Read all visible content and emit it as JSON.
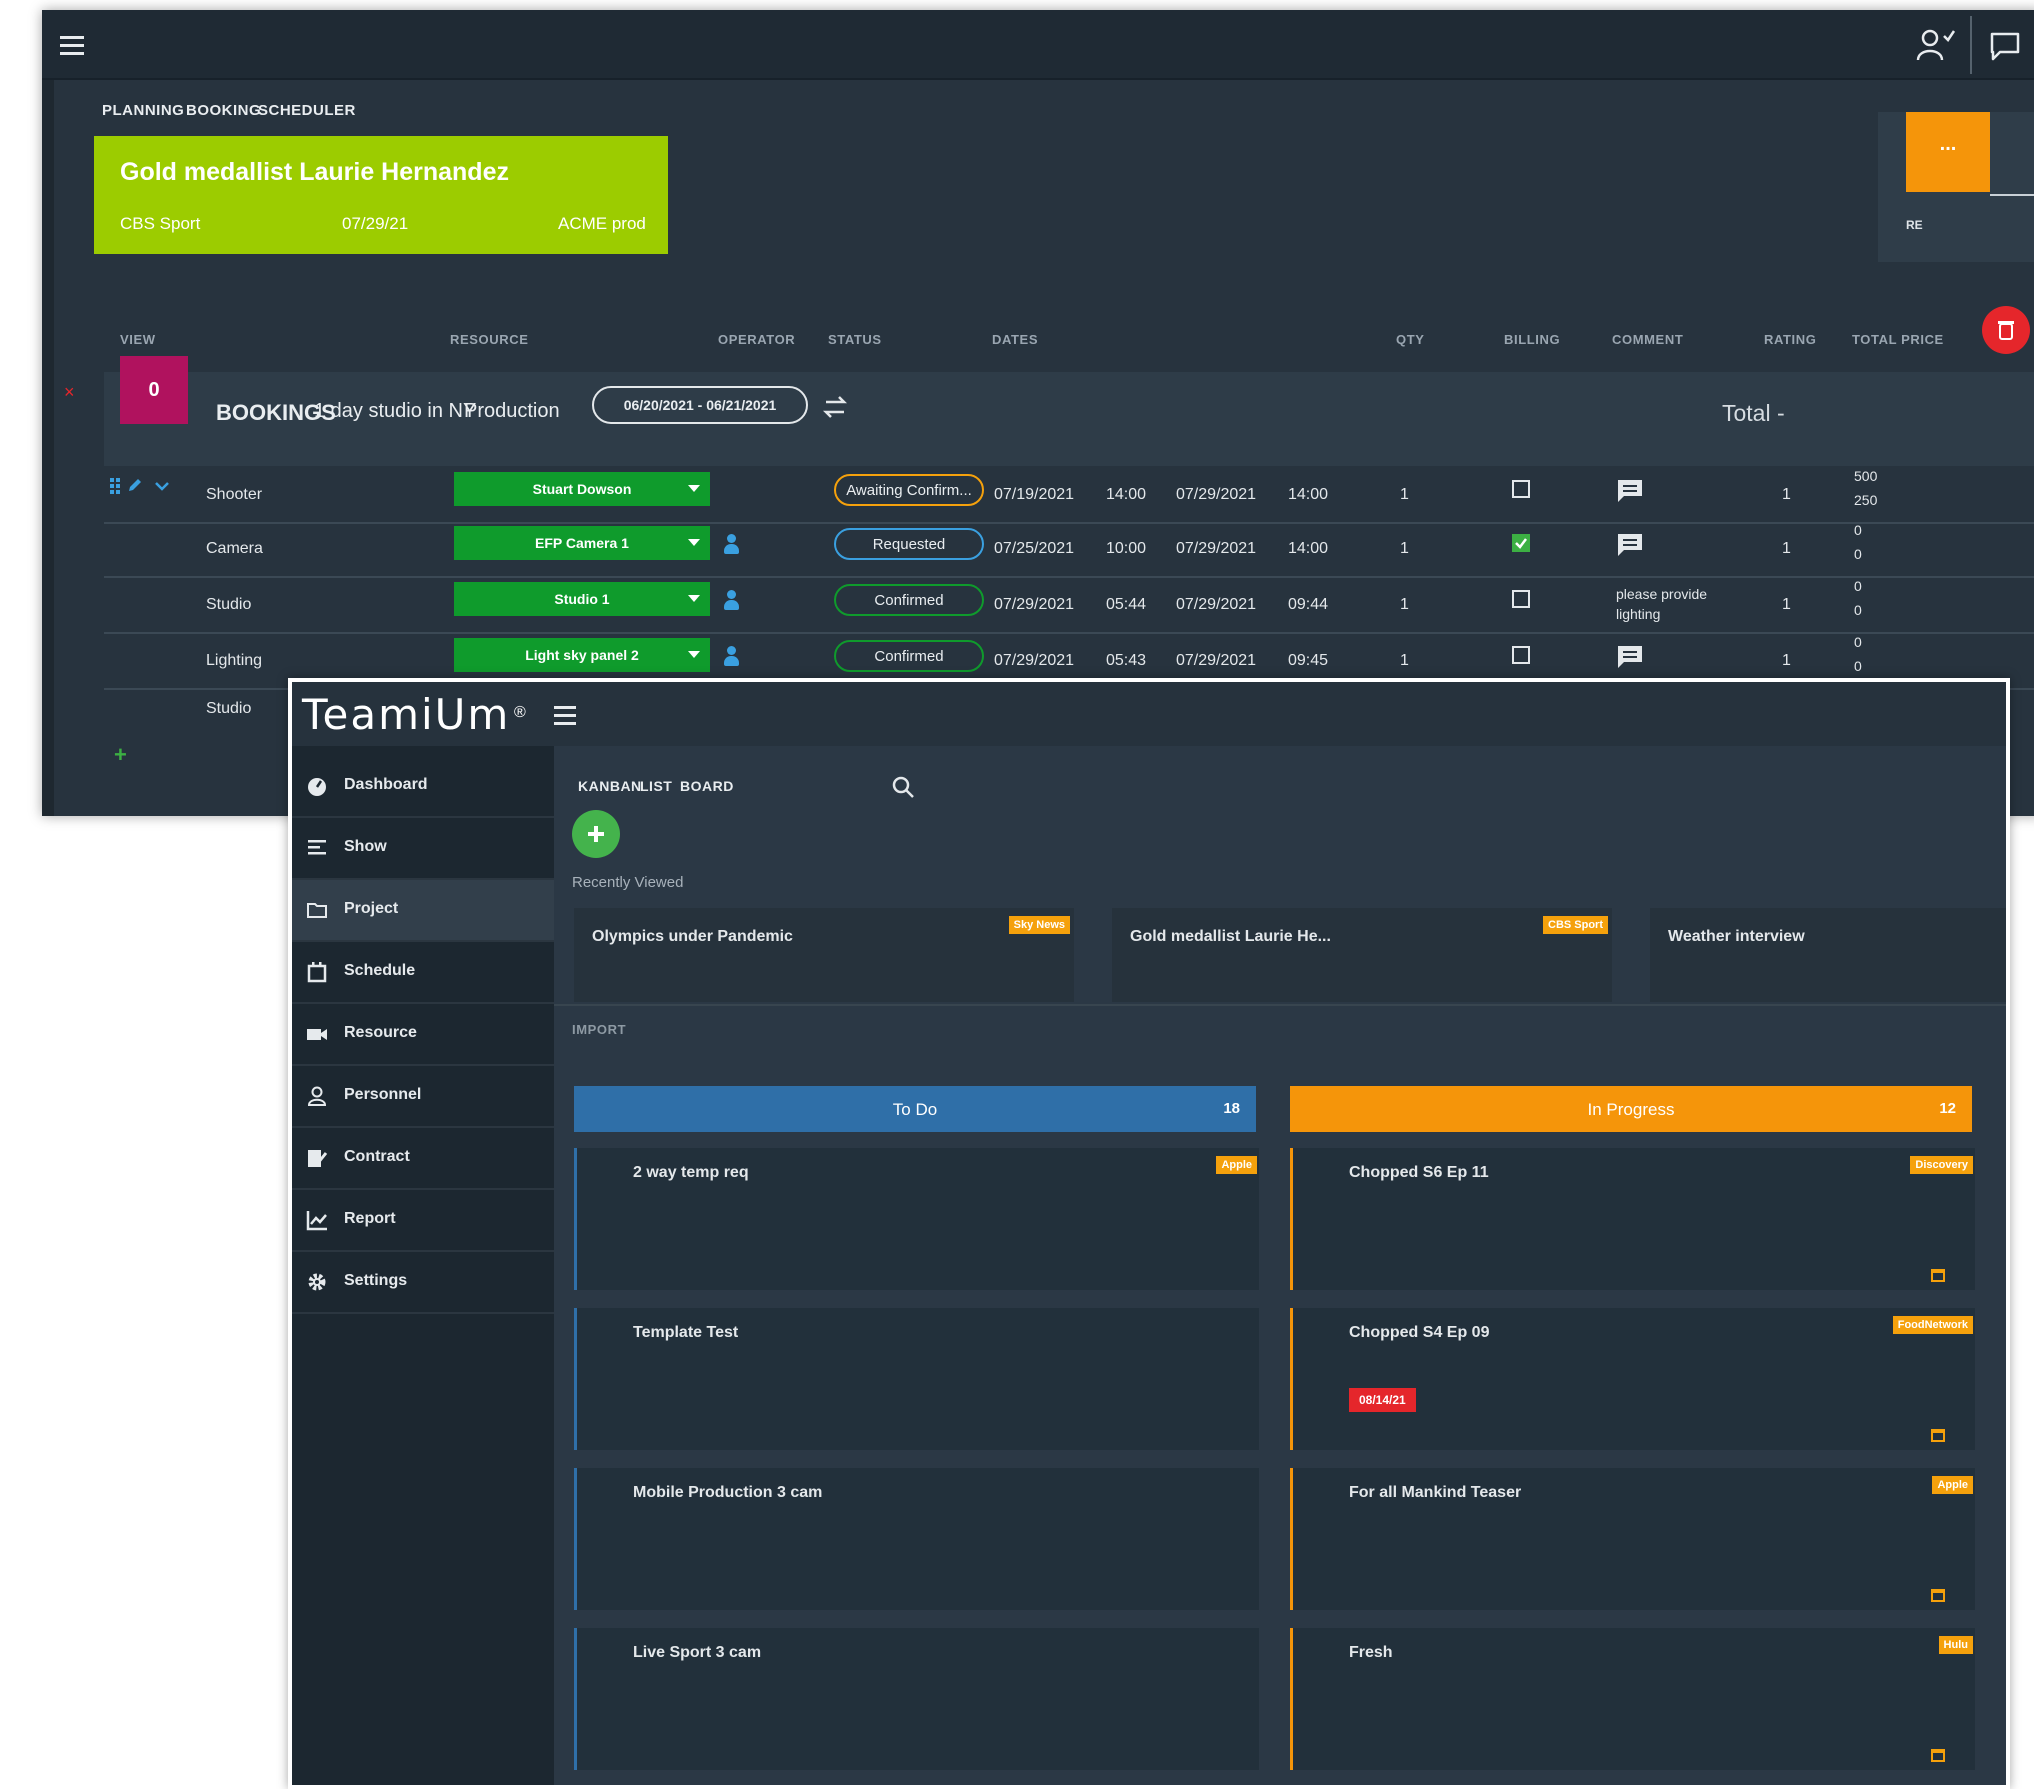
{
  "planning_window": {
    "tabs": [
      "PLANNING",
      "BOOKING",
      "SCHEDULER"
    ],
    "project_card": {
      "title": "Gold medallist Laurie Hernandez",
      "client": "CBS Sport",
      "date": "07/29/21",
      "producer": "ACME prod"
    },
    "side_panel": {
      "label": "RE",
      "menu_label": "..."
    },
    "columns": [
      "VIEW",
      "RESOURCE",
      "OPERATOR",
      "STATUS",
      "DATES",
      "QTY",
      "BILLING",
      "COMMENT",
      "RATING",
      "TOTAL PRICE"
    ],
    "booking_group": {
      "badge": "0",
      "label": "BOOKINGS",
      "name": "1 day studio in NY",
      "type": "Production",
      "date_range": "06/20/2021 - 06/21/2021",
      "total": "Total -",
      "remove_mark": "×"
    },
    "rows": [
      {
        "role": "Shooter",
        "resource": "Stuart Dowson",
        "operator": false,
        "status": "Awaiting Confirm...",
        "status_kind": "awaiting",
        "start_date": "07/19/2021",
        "start_time": "14:00",
        "end_date": "07/29/2021",
        "end_time": "14:00",
        "qty": "1",
        "billing": false,
        "comment": "",
        "rating": "1",
        "price": "500",
        "price2": "250"
      },
      {
        "role": "Camera",
        "resource": "EFP Camera 1",
        "operator": true,
        "status": "Requested",
        "status_kind": "requested",
        "start_date": "07/25/2021",
        "start_time": "10:00",
        "end_date": "07/29/2021",
        "end_time": "14:00",
        "qty": "1",
        "billing": true,
        "comment": "",
        "rating": "1",
        "price": "0",
        "price2": "0"
      },
      {
        "role": "Studio",
        "resource": "Studio 1",
        "operator": true,
        "status": "Confirmed",
        "status_kind": "confirmed",
        "start_date": "07/29/2021",
        "start_time": "05:44",
        "end_date": "07/29/2021",
        "end_time": "09:44",
        "qty": "1",
        "billing": false,
        "comment": "please provide lighting",
        "rating": "1",
        "price": "0",
        "price2": "0"
      },
      {
        "role": "Lighting",
        "resource": "Light sky panel 2",
        "operator": true,
        "status": "Confirmed",
        "status_kind": "confirmed",
        "start_date": "07/29/2021",
        "start_time": "05:43",
        "end_date": "07/29/2021",
        "end_time": "09:45",
        "qty": "1",
        "billing": false,
        "comment": "",
        "rating": "1",
        "price": "0",
        "price2": "0"
      }
    ],
    "extra_row": {
      "role": "Studio"
    },
    "add_symbol": "+"
  },
  "teamium_window": {
    "logo": "TeamiUm",
    "logo_mark": "®",
    "nav": [
      {
        "label": "Dashboard",
        "icon": "dashboard-icon"
      },
      {
        "label": "Show",
        "icon": "list-icon"
      },
      {
        "label": "Project",
        "icon": "folder-icon"
      },
      {
        "label": "Schedule",
        "icon": "calendar-icon"
      },
      {
        "label": "Resource",
        "icon": "video-camera-icon"
      },
      {
        "label": "Personnel",
        "icon": "person-icon"
      },
      {
        "label": "Contract",
        "icon": "contract-icon"
      },
      {
        "label": "Report",
        "icon": "chart-icon"
      },
      {
        "label": "Settings",
        "icon": "gear-icon"
      }
    ],
    "view_tabs": [
      "KANBAN",
      "LIST",
      "BOARD"
    ],
    "recently_viewed_label": "Recently Viewed",
    "recent": [
      {
        "title": "Olympics under Pandemic",
        "tag": "Sky News"
      },
      {
        "title": "Gold medallist Laurie He...",
        "tag": "CBS Sport"
      },
      {
        "title": "Weather interview",
        "tag": ""
      }
    ],
    "import_label": "IMPORT",
    "columns": [
      {
        "title": "To Do",
        "count": "18",
        "color": "#2f6fa8",
        "cards": [
          {
            "title": "2 way temp req",
            "tag": "Apple",
            "date": ""
          },
          {
            "title": "Template Test",
            "tag": "",
            "date": ""
          },
          {
            "title": "Mobile Production 3 cam",
            "tag": "",
            "date": ""
          },
          {
            "title": "Live Sport 3 cam",
            "tag": "",
            "date": ""
          }
        ]
      },
      {
        "title": "In Progress",
        "count": "12",
        "color": "#f5950a",
        "cards": [
          {
            "title": "Chopped S6 Ep 11",
            "tag": "Discovery",
            "date": ""
          },
          {
            "title": "Chopped S4 Ep 09",
            "tag": "FoodNetwork",
            "date": "08/14/21"
          },
          {
            "title": "For all Mankind Teaser",
            "tag": "Apple",
            "date": ""
          },
          {
            "title": "Fresh",
            "tag": "Hulu",
            "date": ""
          }
        ]
      }
    ]
  },
  "colors": {
    "accent_green": "#9ccc00",
    "orange": "#f5950a",
    "blue": "#2f6fa8",
    "magenta": "#b0125e",
    "red": "#e5262b"
  }
}
